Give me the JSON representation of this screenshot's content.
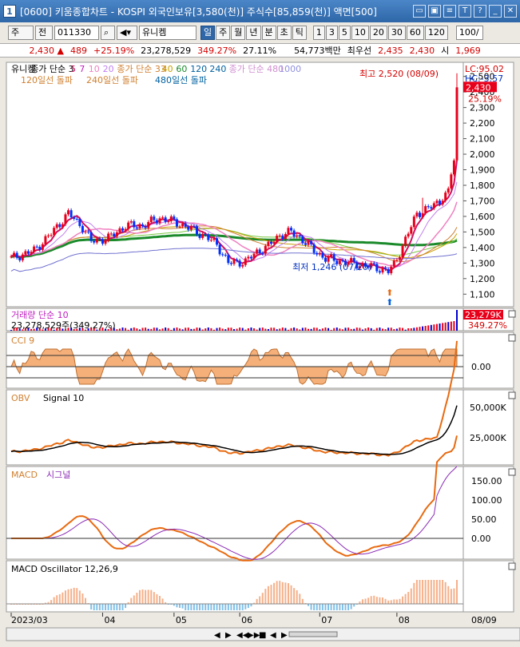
{
  "window": {
    "number": "1",
    "title": "[0600] 키움종합차트 - KOSPI 외국인보유[3,580(천)] 주식수[85,859(천)] 액면[500]",
    "controls": [
      "▭",
      "▣",
      "≡",
      "T",
      "?",
      "_",
      "✕"
    ]
  },
  "toolbar": {
    "market": "주",
    "scope": "전",
    "code": "011330",
    "name": "유니켐",
    "periods": [
      "일",
      "주",
      "월",
      "년",
      "분",
      "초",
      "틱"
    ],
    "active_period": "일",
    "intervals": [
      "1",
      "3",
      "5",
      "10",
      "20",
      "30",
      "60",
      "120"
    ],
    "count": "100/"
  },
  "quote": {
    "price": "2,430",
    "change": "489",
    "change_pct": "+25.19%",
    "volume": "23,278,529",
    "vol_ratio": "349.27%",
    "turnover": "27.11%",
    "amount": "54,773백만",
    "bid_label": "최우선",
    "bid": "2,435",
    "ask": "2,430",
    "open_label": "시",
    "open": "1,969"
  },
  "price_panel": {
    "stock_label": "유니켐",
    "ma_label": "종가 단순",
    "ma_short": [
      "3",
      "5",
      "7",
      "10",
      "20"
    ],
    "ma_mid_label": "종가 단순 33",
    "ma_mid": [
      "40",
      "60",
      "120",
      "240"
    ],
    "ma_long_label": "종가 단순 480",
    "ma_long": [
      "1000"
    ],
    "breakout_120": "120일선 돌파",
    "breakout_240": "240일선 돌파",
    "breakout_480": "480일선 돌파",
    "lc": "LC:95.02",
    "hc": "HC:-3.57",
    "max_label": "최고 2,520 (08/09)",
    "min_label": "최저 1,246 (07/20)",
    "price_tag": "2,430",
    "pct_tag": "25.19%"
  },
  "volume_panel": {
    "title": "거래량 단순 10",
    "subtitle": "23,278,529주(349.27%)",
    "tag1": "23,279K",
    "tag2": "349.27%"
  },
  "cci_panel": {
    "title": "CCI 9",
    "axis_label": "0.00"
  },
  "obv_panel": {
    "title_a": "OBV",
    "title_b": "Signal 10",
    "ticks": [
      "50,000K",
      "25,000K"
    ]
  },
  "macd_panel": {
    "title_a": "MACD",
    "title_b": "시그널",
    "ticks": [
      "150.00",
      "100.00",
      "50.00",
      "0.00"
    ]
  },
  "osc_panel": {
    "title": "MACD Oscillator 12,26,9"
  },
  "x_axis": {
    "labels": [
      "2023/03",
      "04",
      "05",
      "06",
      "07",
      "08"
    ],
    "right_label": "08/09"
  },
  "colors": {
    "up": "#e8001a",
    "down": "#0030ff",
    "obv": "#e86a10",
    "signal": "#000000",
    "macd_signal": "#8a2bb5",
    "cci_fill": "#f5b07a",
    "cci_neg": "#7ec0e0",
    "osc_pos": "#f5b08a",
    "osc_neg": "#80c0e8",
    "vol_up": "#e8001a",
    "vol_down": "#0000d0"
  },
  "chart_data": [
    {
      "type": "candlestick",
      "title": "유니켐",
      "ylim": [
        1050,
        2560
      ],
      "y_ticks": [
        2500,
        2400,
        2300,
        2200,
        2100,
        2000,
        1900,
        1800,
        1700,
        1600,
        1500,
        1400,
        1300,
        1200,
        1100
      ],
      "x_labels": [
        "2023/03",
        "04",
        "05",
        "06",
        "07",
        "08"
      ],
      "close_keypoints": [
        [
          0,
          1330
        ],
        [
          8,
          1380
        ],
        [
          14,
          1490
        ],
        [
          20,
          1620
        ],
        [
          25,
          1530
        ],
        [
          28,
          1440
        ],
        [
          34,
          1460
        ],
        [
          40,
          1540
        ],
        [
          46,
          1540
        ],
        [
          52,
          1590
        ],
        [
          58,
          1560
        ],
        [
          64,
          1510
        ],
        [
          68,
          1470
        ],
        [
          72,
          1420
        ],
        [
          76,
          1300
        ],
        [
          82,
          1310
        ],
        [
          86,
          1370
        ],
        [
          90,
          1410
        ],
        [
          94,
          1480
        ],
        [
          98,
          1500
        ],
        [
          102,
          1450
        ],
        [
          106,
          1380
        ],
        [
          110,
          1330
        ],
        [
          116,
          1310
        ],
        [
          122,
          1290
        ],
        [
          128,
          1270
        ],
        [
          132,
          1246
        ],
        [
          134,
          1290
        ],
        [
          138,
          1450
        ],
        [
          142,
          1620
        ],
        [
          146,
          1650
        ],
        [
          150,
          1700
        ],
        [
          153,
          1780
        ],
        [
          155,
          1960
        ],
        [
          156,
          2430
        ]
      ],
      "max": {
        "value": 2520,
        "date": "08/09"
      },
      "min": {
        "value": 1246,
        "date": "07/20"
      },
      "last": 2430
    },
    {
      "type": "bar",
      "title": "거래량 단순 10",
      "last": 23278529,
      "unit": "K"
    },
    {
      "type": "line",
      "title": "OBV",
      "series": [
        {
          "name": "OBV"
        },
        {
          "name": "Signal 10"
        }
      ],
      "y_ticks": [
        50000,
        25000
      ]
    },
    {
      "type": "line",
      "title": "MACD",
      "series": [
        {
          "name": "MACD"
        },
        {
          "name": "시그널"
        }
      ],
      "y_ticks": [
        150,
        100,
        50,
        0
      ]
    }
  ]
}
